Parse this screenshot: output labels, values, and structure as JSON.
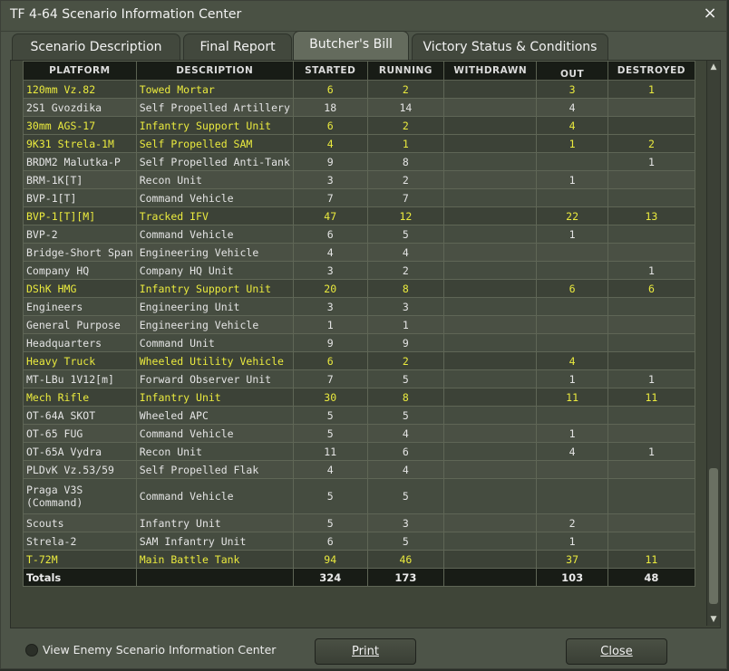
{
  "window": {
    "title": "TF 4-64 Scenario Information Center",
    "close_label": "×"
  },
  "tabs": [
    {
      "label": "Scenario Description"
    },
    {
      "label": "Final Report"
    },
    {
      "label": "Butcher's Bill",
      "active": true
    },
    {
      "label": "Victory Status & Conditions"
    }
  ],
  "table": {
    "headers": {
      "platform": "PLATFORM",
      "description": "DESCRIPTION",
      "started": "STARTED",
      "running": "RUNNING",
      "withdrawn": "WITHDRAWN",
      "out": "OUT",
      "destroyed": "DESTROYED"
    },
    "rows": [
      {
        "platform": "120mm Vz.82",
        "description": "Towed Mortar",
        "started": "6",
        "running": "2",
        "withdrawn": "",
        "out": "3",
        "destroyed": "1",
        "hl": true
      },
      {
        "platform": "2S1 Gvozdika",
        "description": "Self Propelled Artillery",
        "started": "18",
        "running": "14",
        "withdrawn": "",
        "out": "4",
        "destroyed": "",
        "hl": false
      },
      {
        "platform": "30mm AGS-17",
        "description": "Infantry Support Unit",
        "started": "6",
        "running": "2",
        "withdrawn": "",
        "out": "4",
        "destroyed": "",
        "hl": true
      },
      {
        "platform": "9K31 Strela-1M",
        "description": "Self Propelled SAM",
        "started": "4",
        "running": "1",
        "withdrawn": "",
        "out": "1",
        "destroyed": "2",
        "hl": true
      },
      {
        "platform": "BRDM2 Malutka-P",
        "description": "Self Propelled Anti-Tank",
        "started": "9",
        "running": "8",
        "withdrawn": "",
        "out": "",
        "destroyed": "1",
        "hl": false
      },
      {
        "platform": "BRM-1K[T]",
        "description": "Recon Unit",
        "started": "3",
        "running": "2",
        "withdrawn": "",
        "out": "1",
        "destroyed": "",
        "hl": false
      },
      {
        "platform": "BVP-1[T]",
        "description": "Command Vehicle",
        "started": "7",
        "running": "7",
        "withdrawn": "",
        "out": "",
        "destroyed": "",
        "hl": false
      },
      {
        "platform": "BVP-1[T][M]",
        "description": "Tracked IFV",
        "started": "47",
        "running": "12",
        "withdrawn": "",
        "out": "22",
        "destroyed": "13",
        "hl": true
      },
      {
        "platform": "BVP-2",
        "description": "Command Vehicle",
        "started": "6",
        "running": "5",
        "withdrawn": "",
        "out": "1",
        "destroyed": "",
        "hl": false
      },
      {
        "platform": "Bridge-Short Span",
        "description": "Engineering Vehicle",
        "started": "4",
        "running": "4",
        "withdrawn": "",
        "out": "",
        "destroyed": "",
        "hl": false
      },
      {
        "platform": "Company HQ",
        "description": "Company HQ Unit",
        "started": "3",
        "running": "2",
        "withdrawn": "",
        "out": "",
        "destroyed": "1",
        "hl": false
      },
      {
        "platform": "DShK HMG",
        "description": "Infantry Support Unit",
        "started": "20",
        "running": "8",
        "withdrawn": "",
        "out": "6",
        "destroyed": "6",
        "hl": true
      },
      {
        "platform": "Engineers",
        "description": "Engineering Unit",
        "started": "3",
        "running": "3",
        "withdrawn": "",
        "out": "",
        "destroyed": "",
        "hl": false
      },
      {
        "platform": "General Purpose",
        "description": "Engineering Vehicle",
        "started": "1",
        "running": "1",
        "withdrawn": "",
        "out": "",
        "destroyed": "",
        "hl": false
      },
      {
        "platform": "Headquarters",
        "description": "Command Unit",
        "started": "9",
        "running": "9",
        "withdrawn": "",
        "out": "",
        "destroyed": "",
        "hl": false
      },
      {
        "platform": "Heavy Truck",
        "description": "Wheeled Utility Vehicle",
        "started": "6",
        "running": "2",
        "withdrawn": "",
        "out": "4",
        "destroyed": "",
        "hl": true
      },
      {
        "platform": "MT-LBu 1V12[m]",
        "description": "Forward Observer Unit",
        "started": "7",
        "running": "5",
        "withdrawn": "",
        "out": "1",
        "destroyed": "1",
        "hl": false
      },
      {
        "platform": "Mech Rifle",
        "description": "Infantry Unit",
        "started": "30",
        "running": "8",
        "withdrawn": "",
        "out": "11",
        "destroyed": "11",
        "hl": true
      },
      {
        "platform": "OT-64A SKOT",
        "description": "Wheeled APC",
        "started": "5",
        "running": "5",
        "withdrawn": "",
        "out": "",
        "destroyed": "",
        "hl": false
      },
      {
        "platform": "OT-65 FUG",
        "description": "Command Vehicle",
        "started": "5",
        "running": "4",
        "withdrawn": "",
        "out": "1",
        "destroyed": "",
        "hl": false
      },
      {
        "platform": "OT-65A Vydra",
        "description": "Recon Unit",
        "started": "11",
        "running": "6",
        "withdrawn": "",
        "out": "4",
        "destroyed": "1",
        "hl": false
      },
      {
        "platform": "PLDvK Vz.53/59",
        "description": "Self Propelled Flak",
        "started": "4",
        "running": "4",
        "withdrawn": "",
        "out": "",
        "destroyed": "",
        "hl": false
      },
      {
        "platform": "Praga V3S (Command)",
        "description": "Command Vehicle",
        "started": "5",
        "running": "5",
        "withdrawn": "",
        "out": "",
        "destroyed": "",
        "hl": false,
        "tall": true
      },
      {
        "platform": "Scouts",
        "description": "Infantry Unit",
        "started": "5",
        "running": "3",
        "withdrawn": "",
        "out": "2",
        "destroyed": "",
        "hl": false
      },
      {
        "platform": "Strela-2",
        "description": "SAM Infantry Unit",
        "started": "6",
        "running": "5",
        "withdrawn": "",
        "out": "1",
        "destroyed": "",
        "hl": false
      },
      {
        "platform": "T-72M",
        "description": "Main Battle Tank",
        "started": "94",
        "running": "46",
        "withdrawn": "",
        "out": "37",
        "destroyed": "11",
        "hl": true
      }
    ],
    "totals": {
      "label": "Totals",
      "started": "324",
      "running": "173",
      "withdrawn": "",
      "out": "103",
      "destroyed": "48"
    }
  },
  "footer": {
    "checkbox_label": "View Enemy Scenario Information Center",
    "checkbox_checked": false,
    "print_label": "Print",
    "close_label": "Close"
  },
  "colors": {
    "highlight_text": "#eaea3e",
    "normal_text": "#e4e4e4",
    "header_bg": "#181c16"
  }
}
